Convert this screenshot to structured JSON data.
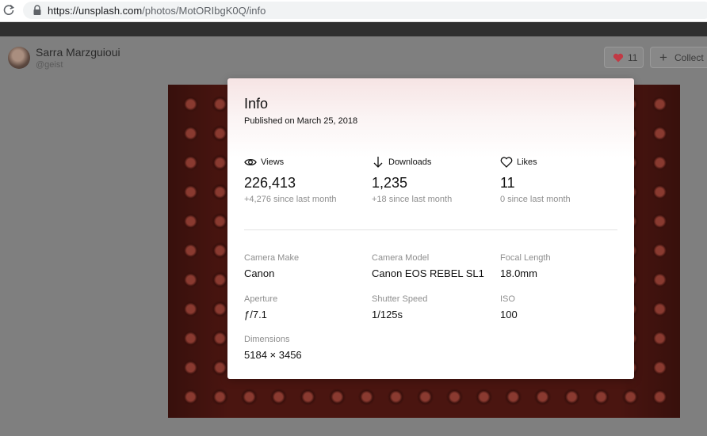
{
  "browser": {
    "url_host": "https://unsplash.com",
    "url_path": "/photos/MotORIbgK0Q/info"
  },
  "author": {
    "name": "Sarra Marzguioui",
    "handle": "@geist"
  },
  "actions": {
    "like_count": "11",
    "collect_label": "Collect"
  },
  "modal": {
    "title": "Info",
    "published": "Published on March 25, 2018",
    "stats": [
      {
        "icon": "eye-icon",
        "label": "Views",
        "value": "226,413",
        "change": "+4,276 since last month"
      },
      {
        "icon": "download-arrow-icon",
        "label": "Downloads",
        "value": "1,235",
        "change": "+18 since last month"
      },
      {
        "icon": "heart-outline-icon",
        "label": "Likes",
        "value": "11",
        "change": "0 since last month"
      }
    ],
    "exif": [
      {
        "label": "Camera Make",
        "value": "Canon"
      },
      {
        "label": "Camera Model",
        "value": "Canon EOS REBEL SL1"
      },
      {
        "label": "Focal Length",
        "value": "18.0mm"
      },
      {
        "label": "Aperture",
        "value": "ƒ/7.1"
      },
      {
        "label": "Shutter Speed",
        "value": "1/125s"
      },
      {
        "label": "ISO",
        "value": "100"
      },
      {
        "label": "Dimensions",
        "value": "5184 × 3456"
      }
    ]
  },
  "colors": {
    "like_heart": "#e0414e",
    "modal_tint": "#f6e4e4"
  }
}
